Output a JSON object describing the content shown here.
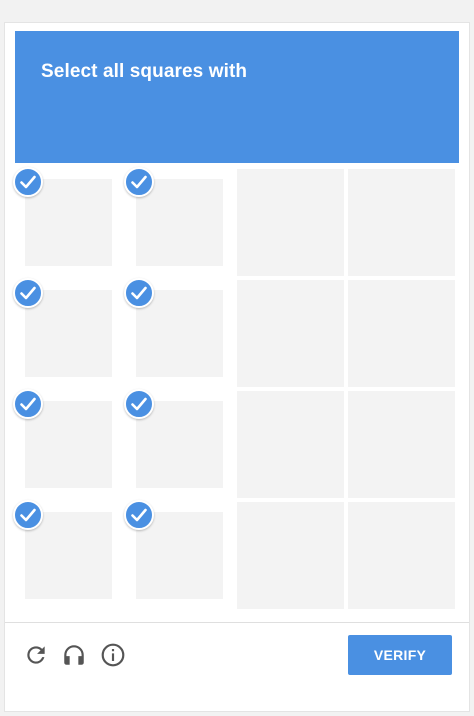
{
  "header": {
    "instruction": "Select all squares with"
  },
  "grid": {
    "rows": 4,
    "columns": 4,
    "tiles": [
      {
        "selected": true
      },
      {
        "selected": true
      },
      {
        "selected": false
      },
      {
        "selected": false
      },
      {
        "selected": true
      },
      {
        "selected": true
      },
      {
        "selected": false
      },
      {
        "selected": false
      },
      {
        "selected": true
      },
      {
        "selected": true
      },
      {
        "selected": false
      },
      {
        "selected": false
      },
      {
        "selected": true
      },
      {
        "selected": true
      },
      {
        "selected": false
      },
      {
        "selected": false
      }
    ]
  },
  "footer": {
    "icons": [
      "reload-icon",
      "headphones-icon",
      "info-icon"
    ],
    "verify_label": "VERIFY"
  },
  "colors": {
    "accent": "#4a90e2",
    "tile": "#f3f3f3",
    "background": "#ffffff"
  }
}
